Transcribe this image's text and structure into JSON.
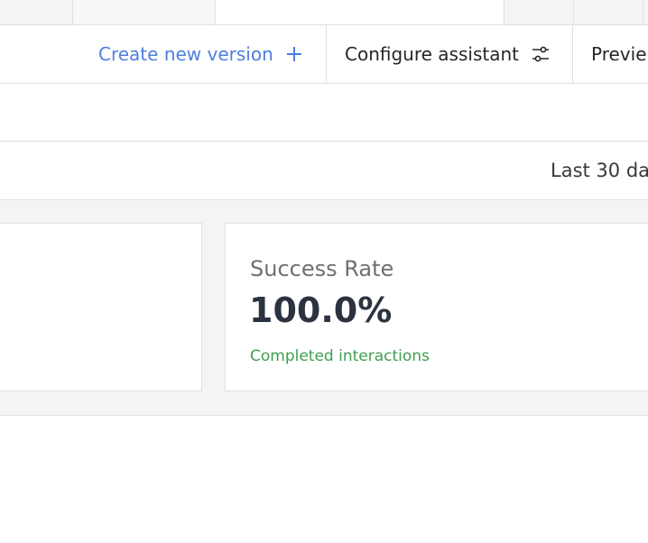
{
  "toolbar": {
    "create_label": "Create new version",
    "configure_label": "Configure assistant",
    "preview_label": "Previe"
  },
  "filter": {
    "date_range": "Last 30 da"
  },
  "stats": {
    "success_rate": {
      "title": "Success Rate",
      "value": "100.0%",
      "subtitle": "Completed interactions"
    }
  },
  "colors": {
    "accent_blue": "#4d7fe0",
    "success_green": "#3f9e4f",
    "value_text": "#2b3340"
  },
  "icons": {
    "create": "plus-icon",
    "configure": "sliders-icon",
    "help": "help-circle-icon",
    "header_action": "sparkle-icon"
  }
}
